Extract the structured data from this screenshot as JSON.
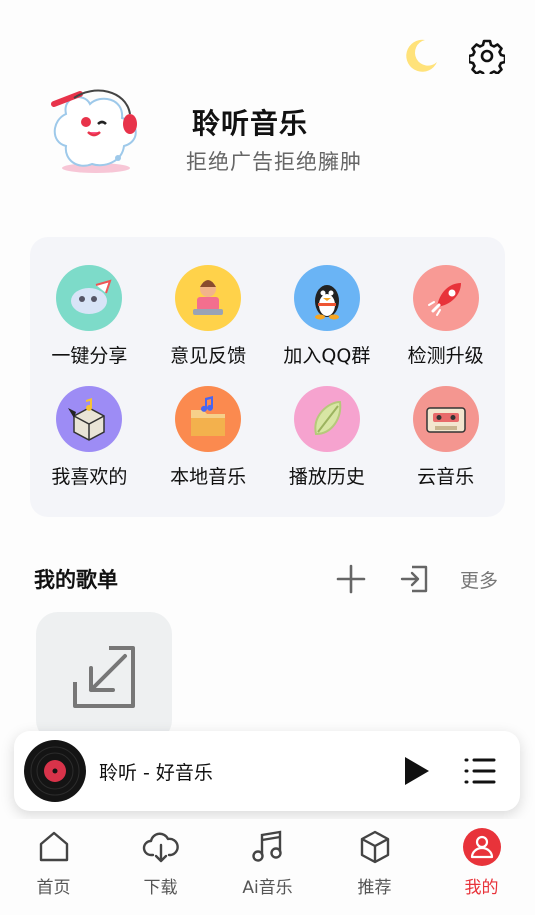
{
  "top_actions": {
    "theme_icon": "moon-icon",
    "settings_icon": "gear-icon"
  },
  "header": {
    "title": "聆听音乐",
    "subtitle": "拒绝广告拒绝臃肿"
  },
  "grid": [
    {
      "label": "一键分享",
      "icon": "share-icon",
      "color": "#7ddbc9"
    },
    {
      "label": "意见反馈",
      "icon": "feedback-icon",
      "color": "#ffd24a"
    },
    {
      "label": "加入QQ群",
      "icon": "qq-penguin-icon",
      "color": "#6ab4f5"
    },
    {
      "label": "检测升级",
      "icon": "rocket-icon",
      "color": "#f89a95"
    },
    {
      "label": "我喜欢的",
      "icon": "favorite-box-icon",
      "color": "#9d8cf5"
    },
    {
      "label": "本地音乐",
      "icon": "folder-music-icon",
      "color": "#fb8a4f"
    },
    {
      "label": "播放历史",
      "icon": "history-leaf-icon",
      "color": "#f6a3cf"
    },
    {
      "label": "云音乐",
      "icon": "cassette-icon",
      "color": "#f49690"
    }
  ],
  "playlist": {
    "title": "我的歌单",
    "add_icon": "plus-icon",
    "import_icon": "import-icon",
    "more_label": "更多"
  },
  "player": {
    "track": "聆听 - 好音乐",
    "play_icon": "play-icon",
    "queue_icon": "queue-list-icon"
  },
  "tabs": [
    {
      "label": "首页",
      "icon": "home-icon"
    },
    {
      "label": "下载",
      "icon": "cloud-download-icon"
    },
    {
      "label": "Ai音乐",
      "icon": "music-note-icon"
    },
    {
      "label": "推荐",
      "icon": "cube-icon"
    },
    {
      "label": "我的",
      "icon": "profile-icon",
      "active": true
    }
  ],
  "colors": {
    "accent": "#e8333a",
    "moon": "#ffe27a"
  }
}
